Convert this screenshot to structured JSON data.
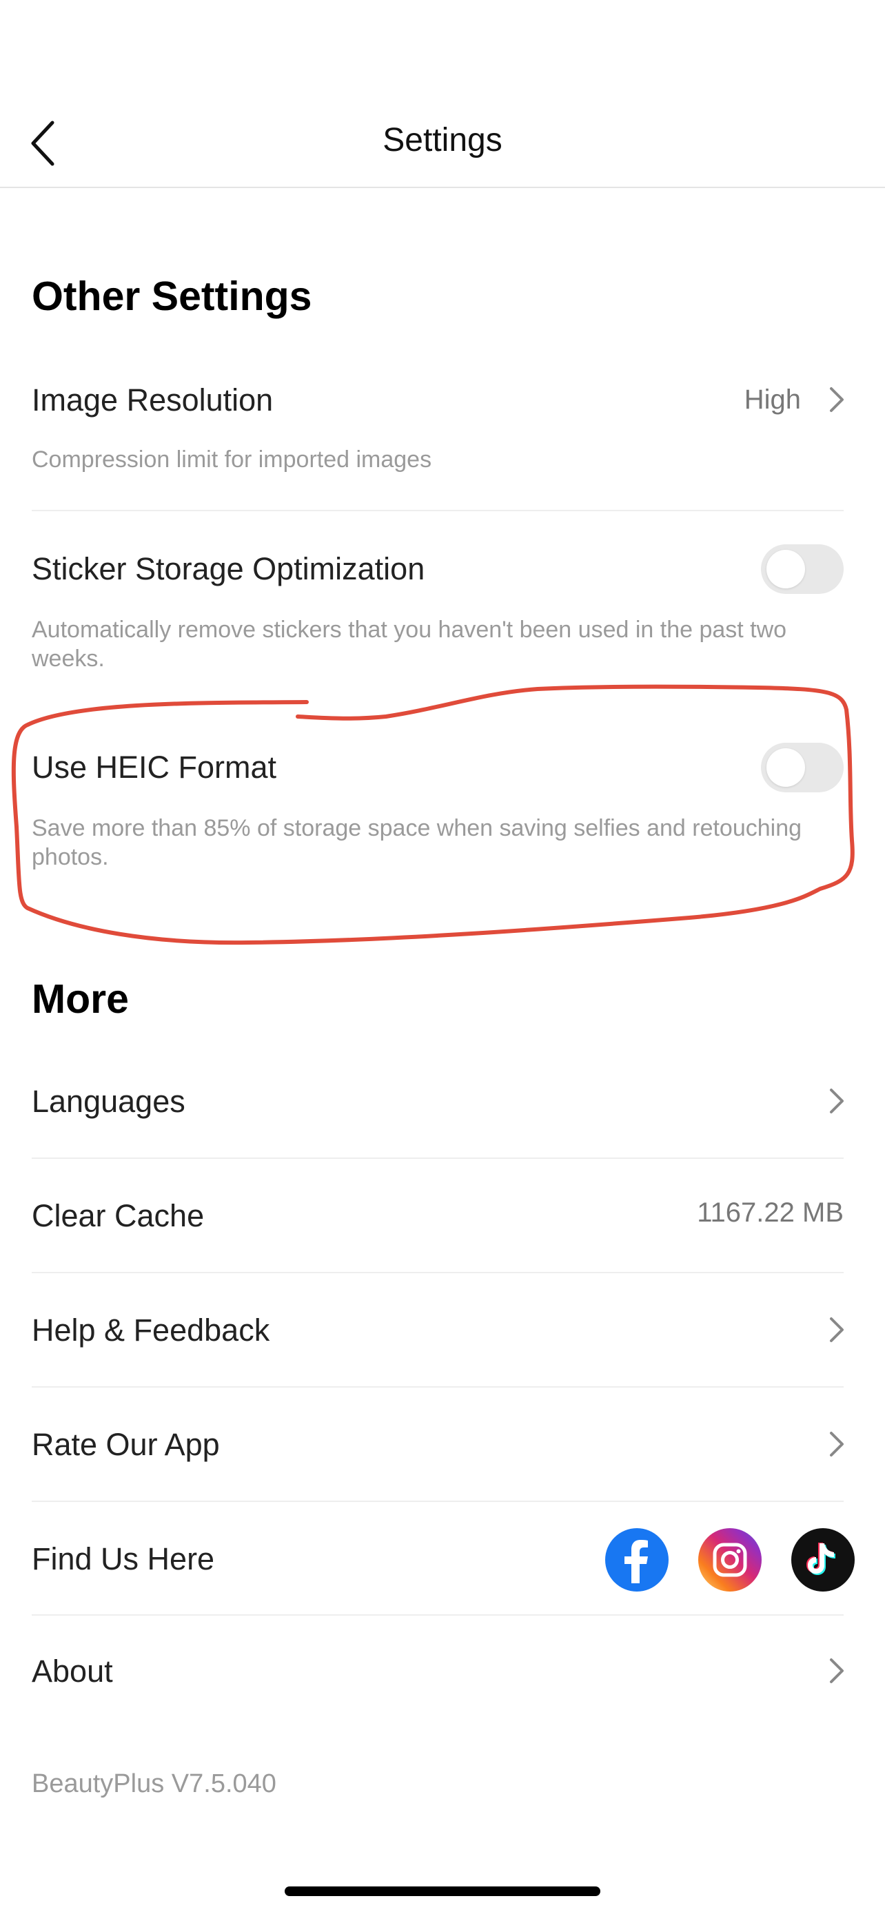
{
  "header": {
    "title": "Settings"
  },
  "sections": {
    "other_title": "Other Settings",
    "more_title": "More"
  },
  "image_resolution": {
    "label": "Image Resolution",
    "value": "High",
    "description": "Compression limit for imported images"
  },
  "sticker_storage": {
    "label": "Sticker Storage Optimization",
    "description": "Automatically remove stickers that you haven't  been used in the past two weeks.",
    "enabled": false
  },
  "heic": {
    "label": "Use HEIC Format",
    "description": "Save more than 85% of storage space when saving selfies and retouching photos.",
    "enabled": false
  },
  "more": {
    "languages": "Languages",
    "clear_cache": "Clear Cache",
    "cache_size": "1167.22 MB",
    "help": "Help & Feedback",
    "rate": "Rate Our App",
    "find_us": "Find Us Here",
    "about": "About"
  },
  "socials": [
    "facebook-icon",
    "instagram-icon",
    "tiktok-icon"
  ],
  "colors": {
    "facebook": "#1877F2",
    "annotation": "#E04B3A",
    "toggle_off": "#E8E8E8"
  },
  "version": "BeautyPlus V7.5.040"
}
